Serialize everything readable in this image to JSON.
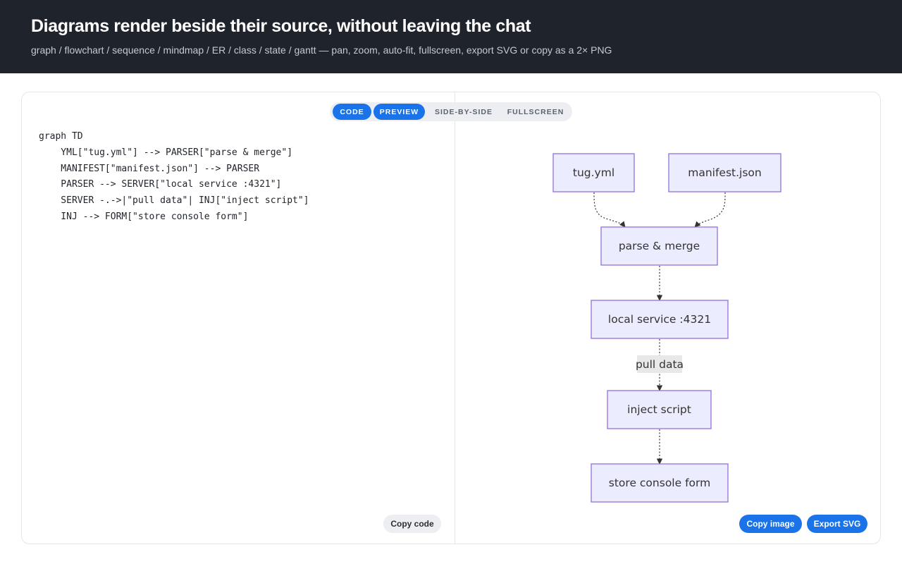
{
  "header": {
    "title": "Diagrams render beside their source, without leaving the chat",
    "subtitle": "graph / flowchart / sequence / mindmap / ER / class / state / gantt — pan, zoom, auto-fit, fullscreen, export SVG or copy as a 2× PNG"
  },
  "tabs": {
    "code": "CODE",
    "preview": "PREVIEW",
    "side_by_side": "SIDE-BY-SIDE",
    "fullscreen": "FULLSCREEN"
  },
  "active_tabs": [
    "CODE",
    "PREVIEW"
  ],
  "code_lines": [
    "graph TD",
    "    YML[\"tug.yml\"] --> PARSER[\"parse & merge\"]",
    "    MANIFEST[\"manifest.json\"] --> PARSER",
    "    PARSER --> SERVER[\"local service :4321\"]",
    "    SERVER -.->|\"pull data\"| INJ[\"inject script\"]",
    "    INJ --> FORM[\"store console form\"]"
  ],
  "buttons": {
    "copy_code": "Copy code",
    "copy_image": "Copy image",
    "export_svg": "Export SVG"
  },
  "diagram": {
    "nodes": {
      "yml": "tug.yml",
      "manifest": "manifest.json",
      "parser": "parse & merge",
      "server": "local service :4321",
      "inj": "inject script",
      "form": "store console form"
    },
    "edge_labels": {
      "server_inj": "pull data"
    }
  },
  "colors": {
    "accent": "#1a73e8",
    "header_bg": "#1f232b",
    "node_fill": "#ececff",
    "node_stroke": "#9370db"
  }
}
